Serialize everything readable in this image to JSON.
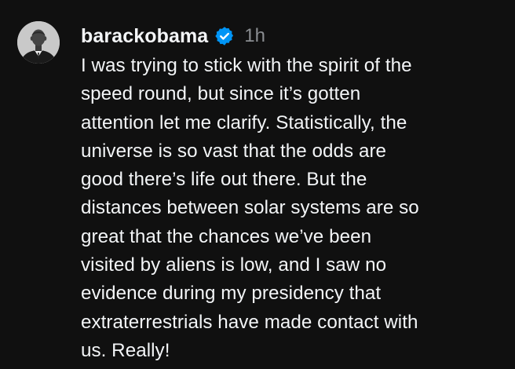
{
  "post": {
    "username": "barackobama",
    "timestamp": "1h",
    "verified_icon": "verified-badge-icon",
    "avatar_icon": "profile-photo",
    "accent_color": "#0095f6",
    "text_lines": [
      "I was trying to stick with the spirit of the",
      "speed round, but since it’s gotten",
      "attention let me clarify. Statistically, the",
      "universe is so vast that the odds are",
      "good there’s life out there. But the",
      "distances between solar systems are so",
      "great that the chances we’ve been",
      "visited by aliens is low, and I saw no",
      "evidence during my presidency that",
      "extraterrestrials have made contact with",
      "us. Really!"
    ]
  }
}
